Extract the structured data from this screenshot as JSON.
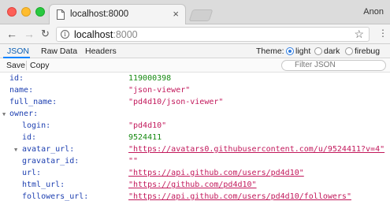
{
  "browser": {
    "tab_title": "localhost:8000",
    "tab_close": "×",
    "profile": "Anon",
    "url_host": "localhost",
    "url_port": ":8000",
    "nav": {
      "back": "←",
      "forward": "→",
      "reload": "↻",
      "star": "☆",
      "menu": "⋮",
      "info": "i"
    }
  },
  "viewer": {
    "tabs": [
      "JSON",
      "Raw Data",
      "Headers"
    ],
    "active_tab": "JSON",
    "theme_label": "Theme:",
    "themes": [
      "light",
      "dark",
      "firebug"
    ],
    "selected_theme": "light",
    "actions": [
      "Save",
      "Copy"
    ],
    "filter_placeholder": "Filter JSON"
  },
  "json_rows": [
    {
      "key": "id:",
      "value": "119000398",
      "type": "number"
    },
    {
      "key": "name:",
      "value": "\"json-viewer\"",
      "type": "string"
    },
    {
      "key": "full_name:",
      "value": "\"pd4d10/json-viewer\"",
      "type": "string"
    },
    {
      "key": "owner:",
      "value": "",
      "type": "object",
      "expanded": true
    },
    {
      "key": "login:",
      "value": "\"pd4d10\"",
      "type": "string"
    },
    {
      "key": "id:",
      "value": "9524411",
      "type": "number"
    },
    {
      "key": "avatar_url:",
      "value": "\"https://avatars0.githubusercontent.com/u/9524411?v=4\"",
      "type": "url"
    },
    {
      "key": "gravatar_id:",
      "value": "\"\"",
      "type": "string"
    },
    {
      "key": "url:",
      "value": "\"https://api.github.com/users/pd4d10\"",
      "type": "url"
    },
    {
      "key": "html_url:",
      "value": "\"https://github.com/pd4d10\"",
      "type": "url"
    },
    {
      "key": "followers_url:",
      "value": "\"https://api.github.com/users/pd4d10/followers\"",
      "type": "url"
    }
  ],
  "colors": {
    "key": "#1d3fb0",
    "number": "#178a12",
    "string": "#c2185b",
    "accent": "#2f7de1"
  }
}
